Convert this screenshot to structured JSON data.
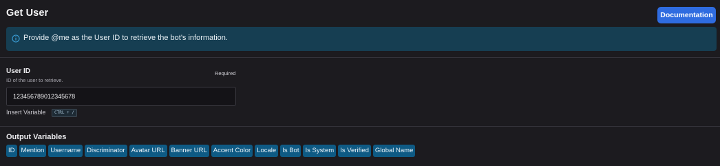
{
  "header": {
    "title": "Get User",
    "documentation_label": "Documentation"
  },
  "info": {
    "icon": "info-icon",
    "text": "Provide @me as the User ID to retrieve the bot's information."
  },
  "field": {
    "label": "User ID",
    "description": "ID of the user to retrieve.",
    "required_label": "Required",
    "value": "123456789012345678",
    "insert_variable_label": "Insert Variable",
    "shortcut": "CTRL + /"
  },
  "output": {
    "title": "Output Variables",
    "variables": [
      {
        "label": "ID"
      },
      {
        "label": "Mention"
      },
      {
        "label": "Username"
      },
      {
        "label": "Discriminator"
      },
      {
        "label": "Avatar URL"
      },
      {
        "label": "Banner URL"
      },
      {
        "label": "Accent Color"
      },
      {
        "label": "Locale"
      },
      {
        "label": "Is Bot"
      },
      {
        "label": "Is System"
      },
      {
        "label": "Is Verified"
      },
      {
        "label": "Global Name"
      }
    ]
  },
  "colors": {
    "background": "#1c1b1f",
    "accent_button": "#2f6ce0",
    "info_banner": "#163e52",
    "info_icon": "#3a9fd8",
    "chip": "#0e5a84"
  }
}
